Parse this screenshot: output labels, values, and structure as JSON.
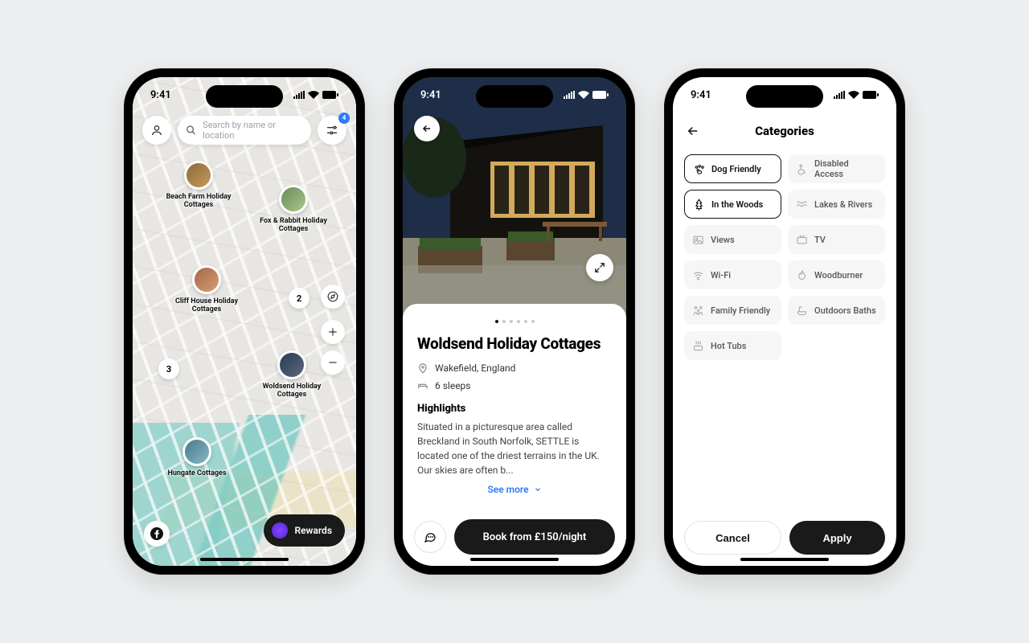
{
  "status": {
    "time": "9:41"
  },
  "phone1": {
    "search_placeholder": "Search by name or location",
    "filter_count": "4",
    "rewards_label": "Rewards",
    "pins": [
      {
        "label": "Beach Farm Holiday Cottages"
      },
      {
        "label": "Fox & Rabbit Holiday Cottages"
      },
      {
        "label": "Cliff House Holiday Cottages"
      },
      {
        "label": "Woldsend Holiday Cottages"
      },
      {
        "label": "Hungate Cottages"
      }
    ],
    "clusters": [
      "2",
      "3"
    ]
  },
  "phone2": {
    "title": "Woldsend Holiday Cottages",
    "location": "Wakefield, England",
    "sleeps": "6 sleeps",
    "highlights_heading": "Highlights",
    "highlights_body": "Situated in a picturesque area called Breckland in South Norfolk, SETTLE is located one of the driest terrains in the UK. Our skies are often b...",
    "see_more": "See more",
    "book_label": "Book from £150/night",
    "page_total": 6,
    "page_active": 1
  },
  "phone3": {
    "title": "Categories",
    "chips": [
      {
        "label": "Dog Friendly",
        "selected": true,
        "icon": "paw"
      },
      {
        "label": "Disabled Access",
        "selected": false,
        "icon": "wheelchair"
      },
      {
        "label": "In the Woods",
        "selected": true,
        "icon": "tree"
      },
      {
        "label": "Lakes & Rivers",
        "selected": false,
        "icon": "water"
      },
      {
        "label": "Views",
        "selected": false,
        "icon": "image"
      },
      {
        "label": "TV",
        "selected": false,
        "icon": "tv"
      },
      {
        "label": "Wi-Fi",
        "selected": false,
        "icon": "wifi"
      },
      {
        "label": "Woodburner",
        "selected": false,
        "icon": "fire"
      },
      {
        "label": "Family Friendly",
        "selected": false,
        "icon": "family"
      },
      {
        "label": "Outdoors Baths",
        "selected": false,
        "icon": "bath"
      },
      {
        "label": "Hot Tubs",
        "selected": false,
        "icon": "hottub"
      }
    ],
    "cancel": "Cancel",
    "apply": "Apply"
  }
}
